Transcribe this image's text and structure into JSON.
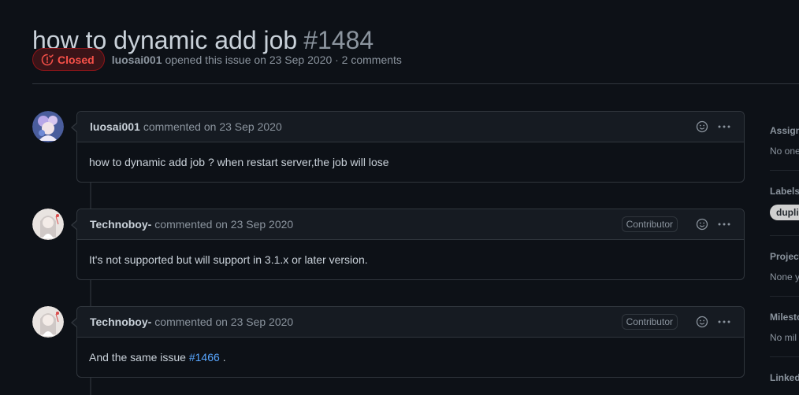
{
  "issue": {
    "title": "how to dynamic add job",
    "number": "#1484",
    "state": "Closed",
    "author": "luosai001",
    "opened_text": "opened this issue on 23 Sep 2020 · 2 comments"
  },
  "comments": [
    {
      "author": "luosai001",
      "action": "commented on 23 Sep 2020",
      "role": "",
      "body": "how to dynamic add job ? when restart server,the job will lose"
    },
    {
      "author": "Technoboy-",
      "action": "commented on 23 Sep 2020",
      "role": "Contributor",
      "body": "It's not supported but will support in 3.1.x or later version."
    },
    {
      "author": "Technoboy-",
      "action": "commented on 23 Sep 2020",
      "role": "Contributor",
      "body_prefix": "And the same issue",
      "link": "#1466",
      "body_suffix": "."
    }
  ],
  "sidebar": {
    "assignees_heading": "Assigne",
    "assignees_value": "No one",
    "labels_heading": "Labels",
    "label": "duplic",
    "projects_heading": "Project",
    "projects_value": "None y",
    "milestone_heading": "Milesto",
    "milestone_value": "No mil",
    "linked_heading": "Linked"
  },
  "colors": {
    "background": "#0d1117",
    "closed": "#f85149",
    "link": "#58a6ff",
    "border": "#30363d"
  },
  "icons": [
    "issue-closed-icon",
    "smiley-icon",
    "kebab-icon"
  ]
}
